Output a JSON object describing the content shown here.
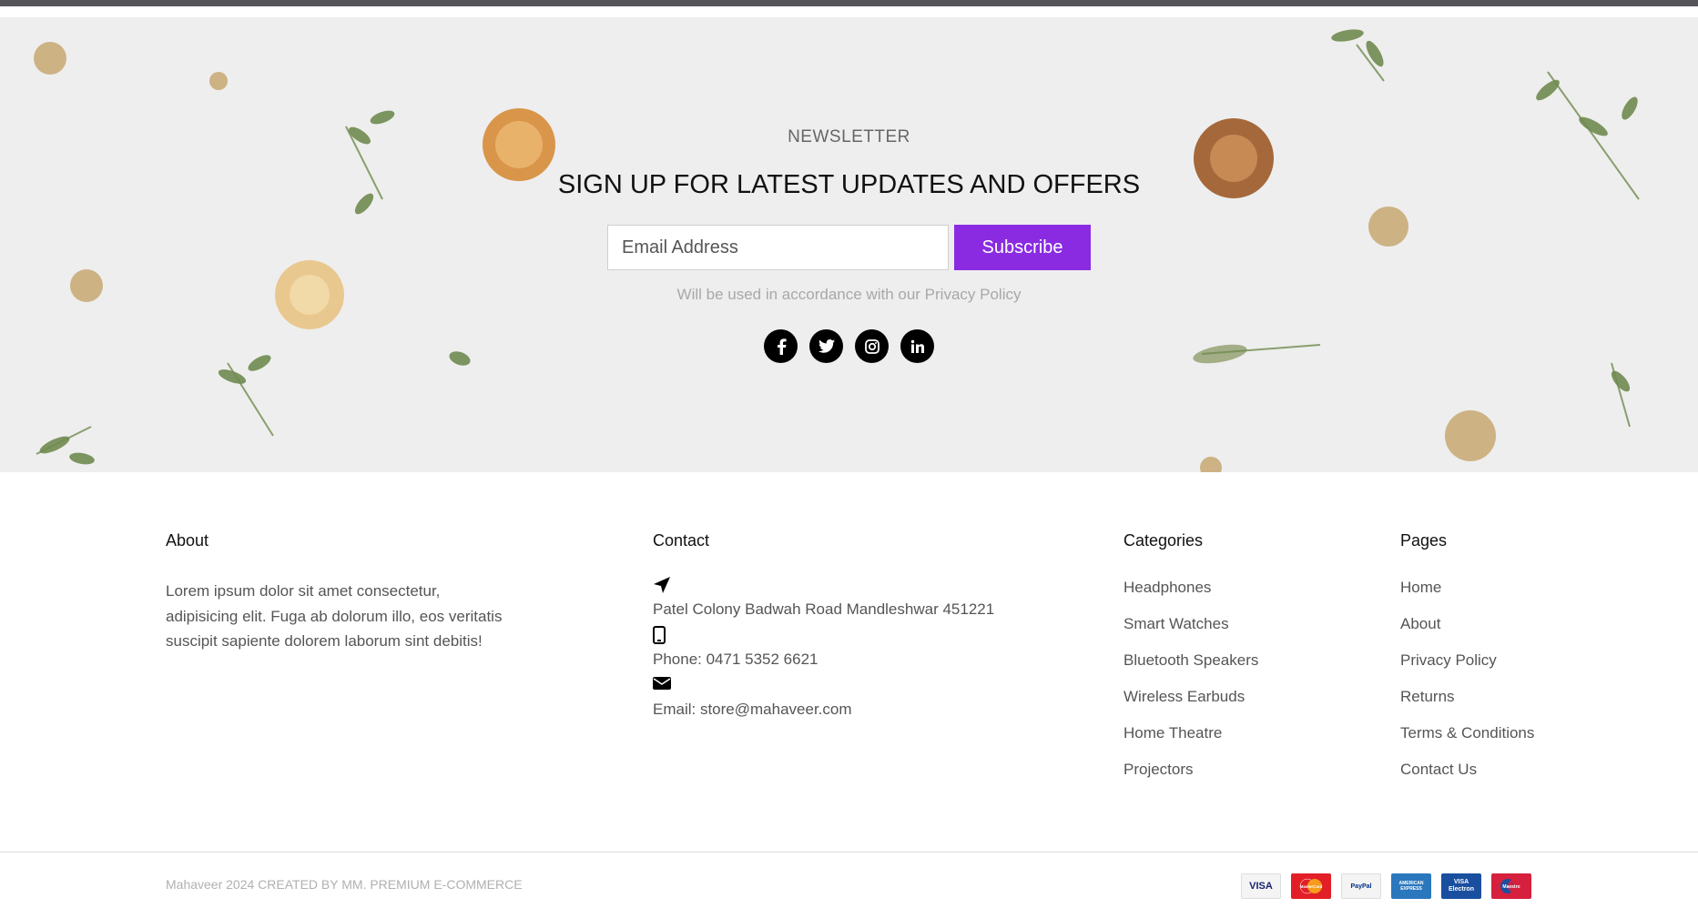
{
  "newsletter": {
    "kicker": "NEWSLETTER",
    "title": "SIGN UP FOR LATEST UPDATES AND OFFERS",
    "email_placeholder": "Email Address",
    "subscribe_label": "Subscribe",
    "note": "Will be used in accordance with our Privacy Policy",
    "accent_color": "#8a2be2",
    "socials": [
      "facebook-icon",
      "twitter-icon",
      "instagram-icon",
      "linkedin-icon"
    ]
  },
  "about": {
    "title": "About",
    "text": "Lorem ipsum dolor sit amet consectetur, adipisicing elit. Fuga ab dolorum illo, eos veritatis suscipit sapiente dolorem laborum sint debitis!"
  },
  "contact": {
    "title": "Contact",
    "address": "Patel Colony Badwah Road Mandleshwar 451221",
    "phone": "Phone: 0471 5352 6621",
    "email": "Email: store@mahaveer.com"
  },
  "categories": {
    "title": "Categories",
    "items": [
      "Headphones",
      "Smart Watches",
      "Bluetooth Speakers",
      "Wireless Earbuds",
      "Home Theatre",
      "Projectors"
    ]
  },
  "pages": {
    "title": "Pages",
    "items": [
      "Home",
      "About",
      "Privacy Policy",
      "Returns",
      "Terms & Conditions",
      "Contact Us"
    ]
  },
  "footer": {
    "copyright": "Mahaveer 2024 CREATED BY MM. PREMIUM E-COMMERCE",
    "payments": [
      {
        "name": "visa-icon",
        "label": "VISA"
      },
      {
        "name": "mastercard-icon",
        "label": "MasterCard"
      },
      {
        "name": "paypal-icon",
        "label": "PayPal"
      },
      {
        "name": "american-express-icon",
        "label": "AMERICAN EXPRESS"
      },
      {
        "name": "visa-electron-icon",
        "label": "VISA Electron"
      },
      {
        "name": "maestro-icon",
        "label": "Maestro"
      }
    ]
  }
}
